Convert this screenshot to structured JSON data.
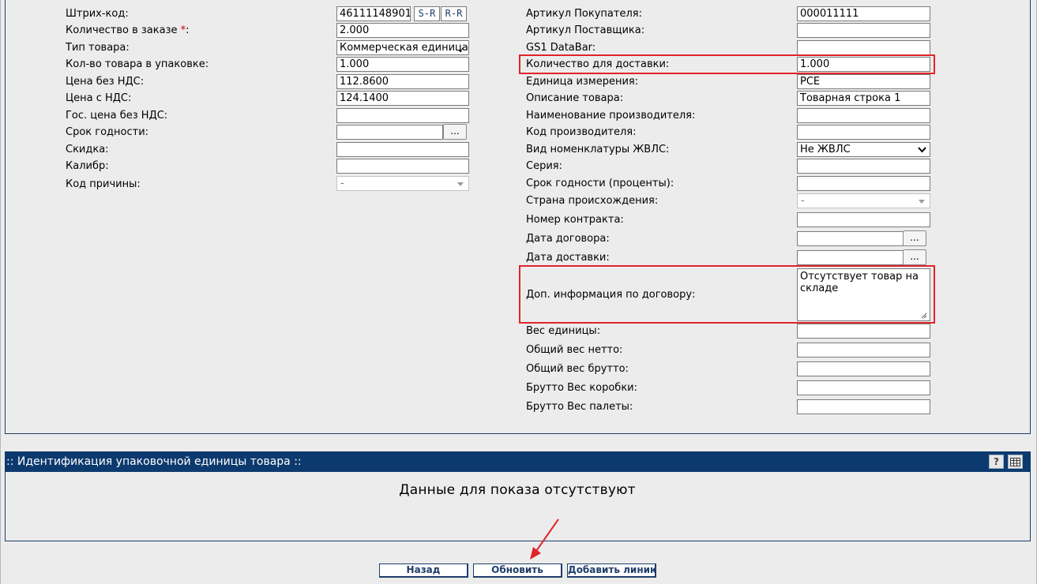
{
  "left_fields": [
    {
      "label": "Штрих-код:",
      "value": "46111148901"
    },
    {
      "label": "Количество в заказе",
      "required": "*",
      "colon": ":",
      "value": "2.000"
    },
    {
      "label": "Тип товара:",
      "value": "Коммерческая единица"
    },
    {
      "label": "Кол-во товара в упаковке:",
      "value": "1.000"
    },
    {
      "label": "Цена без НДС:",
      "value": "112.8600"
    },
    {
      "label": "Цена с НДС:",
      "value": "124.1400"
    },
    {
      "label": "Гос. цена без НДС:",
      "value": ""
    },
    {
      "label": "Срок годности:",
      "value": ""
    },
    {
      "label": "Скидка:",
      "value": ""
    },
    {
      "label": "Калибр:",
      "value": ""
    },
    {
      "label": "Код причины:",
      "value": "-"
    }
  ],
  "barcode_buttons": {
    "s_r": "S-R",
    "r_r": "R-R"
  },
  "dots_label": "...",
  "right_fields": [
    {
      "label": "Артикул Покупателя:",
      "value": "000011111"
    },
    {
      "label": "Артикул Поставщика:",
      "value": ""
    },
    {
      "label": "GS1 DataBar:",
      "value": ""
    },
    {
      "label": "Количество для доставки:",
      "value": "1.000"
    },
    {
      "label": "Единица измерения:",
      "value": "PCE"
    },
    {
      "label": "Описание товара:",
      "value": "Товарная строка 1"
    },
    {
      "label": "Наименование производителя:",
      "value": ""
    },
    {
      "label": "Код производителя:",
      "value": ""
    },
    {
      "label": "Вид номенклатуры ЖВЛС:",
      "value": "Не ЖВЛС"
    },
    {
      "label": "Серия:",
      "value": ""
    },
    {
      "label": "Срок годности (проценты):",
      "value": ""
    },
    {
      "label": "Страна происхождения:",
      "value": "-"
    },
    {
      "label": "Номер контракта:",
      "value": ""
    },
    {
      "label": "Дата договора:",
      "value": ""
    },
    {
      "label": "Дата доставки:",
      "value": ""
    },
    {
      "label": "Доп. информация по договору:",
      "value": "Отсутствует товар на складе"
    },
    {
      "label": "Вес единицы:",
      "value": ""
    },
    {
      "label": "Общий вес нетто:",
      "value": ""
    },
    {
      "label": "Общий вес брутто:",
      "value": ""
    },
    {
      "label": "Брутто Вес коробки:",
      "value": ""
    },
    {
      "label": "Брутто Вес палеты:",
      "value": ""
    }
  ],
  "package_section": {
    "title": ":: Идентификация упаковочной единицы товара ::",
    "empty_message": "Данные для показа отсутствуют",
    "help_icon": "?"
  },
  "buttons": {
    "back": "Назад",
    "refresh": "Обновить",
    "add_line": "Добавить линию"
  },
  "colors": {
    "header_bg": "#0d3a6e",
    "highlight": "#e0242a",
    "arrow": "#e0242a"
  }
}
